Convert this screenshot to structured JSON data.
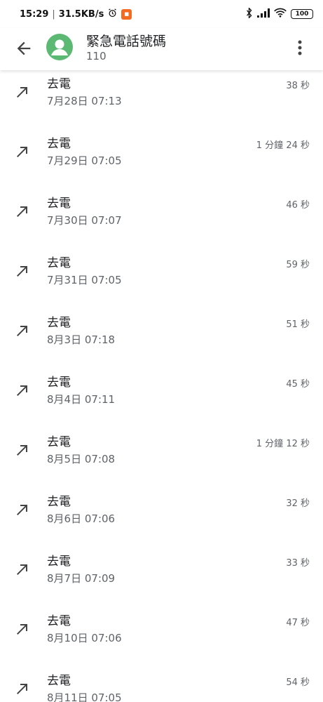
{
  "status_bar": {
    "time": "15:29",
    "speed": "31.5KB/s",
    "battery": "100"
  },
  "header": {
    "contact_name": "緊急電話號碼",
    "contact_number": "110",
    "avatar_color": "#5bb974"
  },
  "calls": [
    {
      "type": "去電",
      "time": "7月28日 07:13",
      "duration": "38 秒"
    },
    {
      "type": "去電",
      "time": "7月29日 07:05",
      "duration": "1 分鐘 24 秒"
    },
    {
      "type": "去電",
      "time": "7月30日 07:07",
      "duration": "46 秒"
    },
    {
      "type": "去電",
      "time": "7月31日 07:05",
      "duration": "59 秒"
    },
    {
      "type": "去電",
      "time": "8月3日 07:18",
      "duration": "51 秒"
    },
    {
      "type": "去電",
      "time": "8月4日 07:11",
      "duration": "45 秒"
    },
    {
      "type": "去電",
      "time": "8月5日 07:08",
      "duration": "1 分鐘 12 秒"
    },
    {
      "type": "去電",
      "time": "8月6日 07:06",
      "duration": "32 秒"
    },
    {
      "type": "去電",
      "time": "8月7日 07:09",
      "duration": "33 秒"
    },
    {
      "type": "去電",
      "time": "8月10日 07:06",
      "duration": "47 秒"
    },
    {
      "type": "去電",
      "time": "8月11日 07:05",
      "duration": "54 秒"
    }
  ]
}
